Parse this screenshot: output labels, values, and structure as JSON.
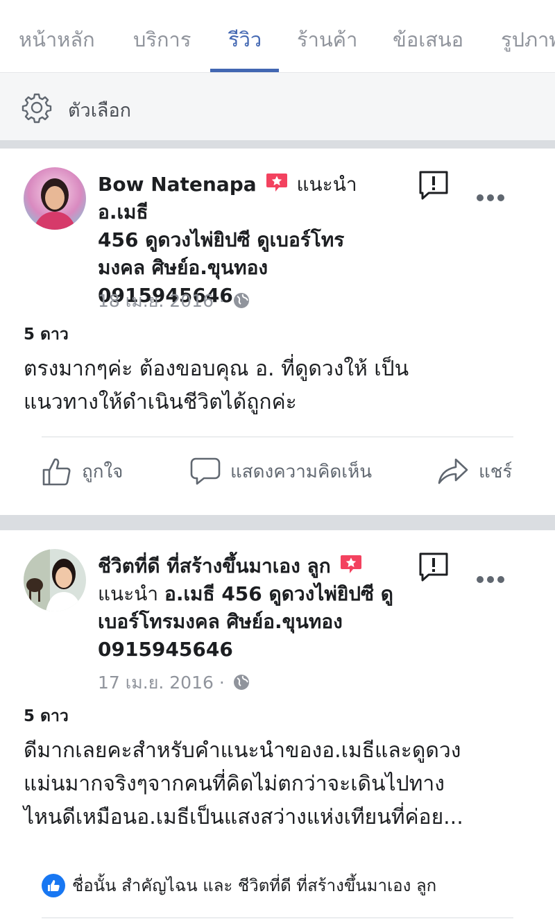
{
  "tabs": [
    {
      "label": "หน้าหลัก"
    },
    {
      "label": "บริการ"
    },
    {
      "label": "รีวิว"
    },
    {
      "label": "ร้านค้า"
    },
    {
      "label": "ข้อเสนอ"
    },
    {
      "label": "รูปภาพ"
    }
  ],
  "active_tab": "รีวิว",
  "options": {
    "label": "ตัวเลือก"
  },
  "reviews": [
    {
      "author": "Bow Natenapa",
      "verb": "แนะนำ",
      "page_name": "อ.เมธี 456 ดูดวงไพ่ยิปซี ดูเบอร์โทรมงคล ศิษย์อ.ขุนทอง 0915945646",
      "name_lines": [
        "456 ดูดวงไพ่ยิปซี ดูเบอร์โทร",
        "มงคล ศิษย์อ.ขุนทอง",
        "0915945646"
      ],
      "name_first": "อ.เมธี",
      "date": "18 เม.ย. 2016",
      "rating": "5 ดาว",
      "text_lines": [
        "ตรงมากๆค่ะ ต้องขอบคุณ อ. ที่ดูดวงให้  เป็น",
        "แนวทางให้ดำเนินชีวิตได้ถูกค่ะ"
      ]
    },
    {
      "author": "ชีวิตที่ดี ที่สร้างขึ้นมาเอง ลูก",
      "verb": "แนะนำ",
      "name_first": "อ.เมธี 456 ดูดวงไพ่ยิปซี ดู",
      "name_lines": [
        "เบอร์โทรมงคล ศิษย์อ.ขุนทอง",
        "0915945646"
      ],
      "date": "17 เม.ย. 2016",
      "rating": "5 ดาว",
      "text_lines": [
        "ดีมากเลยคะสำหรับคำแนะนำของอ.เมธีและดูดวง",
        "แม่นมากจริงๆจากคนที่คิดไม่ตกว่าจะเดินไปทาง",
        "ไหนดีเหมือนอ.เมธีเป็นแสงสว่างแห่งเทียนที่ค่อย..."
      ]
    }
  ],
  "actions": {
    "like": "ถูกใจ",
    "comment": "แสดงความคิดเห็น",
    "share": "แชร์"
  },
  "likes_text": "ชื่อนั้น สำคัญไฉน และ ชีวิตที่ดี ที่สร้างขึ้นมาเอง ลูก",
  "colors": {
    "accent": "#4267b2",
    "badge": "#f3425f",
    "like": "#1877f2"
  }
}
